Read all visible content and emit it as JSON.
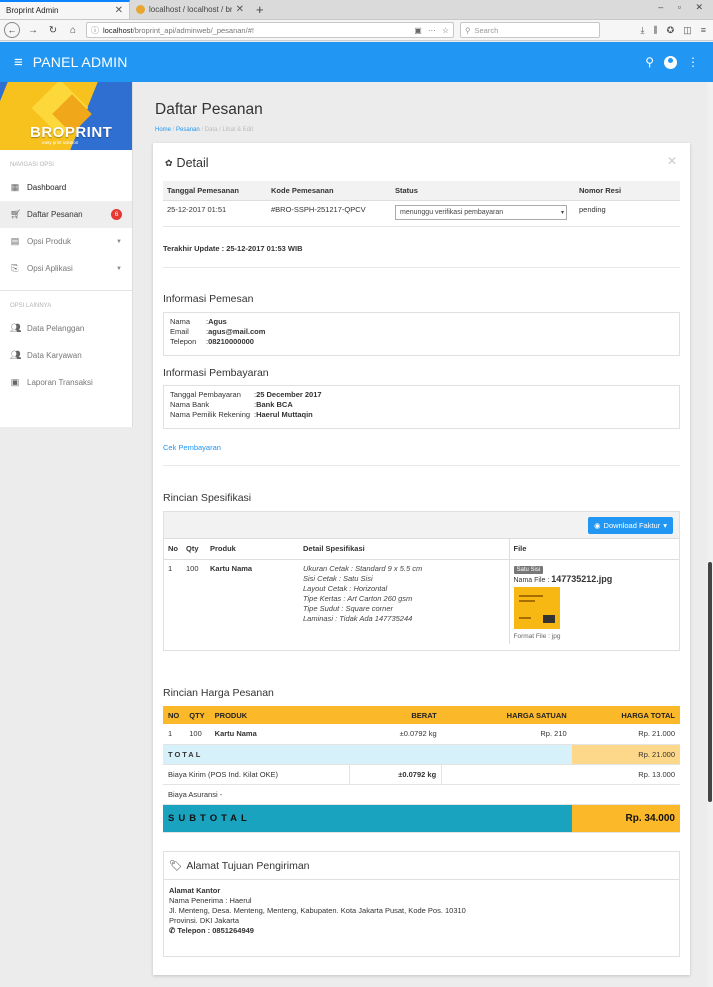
{
  "browser": {
    "tab_active": "Broprint Admin",
    "tab_inactive": "localhost / localhost / bropri",
    "url_host": "localhost",
    "url_path": "/broprint_api/adminweb/_pesanan/#!",
    "search_placeholder": "Search"
  },
  "header": {
    "title": "PANEL ADMIN"
  },
  "brand": {
    "name": "BROPRINT",
    "tagline": "easy print solution"
  },
  "sidebar": {
    "section1": "NAVIGASI OPSI",
    "items1": [
      {
        "label": "Dashboard"
      },
      {
        "label": "Daftar Pesanan",
        "badge": "6"
      },
      {
        "label": "Opsi Produk"
      },
      {
        "label": "Opsi Aplikasi"
      }
    ],
    "section2": "OPSI LAINNYA",
    "items2": [
      {
        "label": "Data Pelanggan"
      },
      {
        "label": "Data Karyawan"
      },
      {
        "label": "Laporan Transaksi"
      }
    ]
  },
  "page": {
    "title": "Daftar Pesanan",
    "breadcrumb": [
      "Home",
      "Pesanan",
      "Data",
      "Lihat & Edit"
    ]
  },
  "detail": {
    "title": "Detail",
    "columns": [
      "Tanggal Pemesanan",
      "Kode Pemesanan",
      "Status",
      "Nomor Resi"
    ],
    "row": {
      "tanggal": "25-12-2017 01:51",
      "kode": "#BRO-SSPH-251217-QPCV",
      "status": "menunggu verifikasi pembayaran",
      "resi": "pending"
    },
    "last_update": "Terakhir Update : 25-12-2017 01:53 WIB"
  },
  "pemesan": {
    "title": "Informasi Pemesan",
    "nama_label": "Nama",
    "nama": "Agus",
    "email_label": "Email",
    "email": "agus@mail.com",
    "telepon_label": "Telepon",
    "telepon": "08210000000"
  },
  "pembayaran": {
    "title": "Informasi Pembayaran",
    "tanggal_label": "Tanggal Pembayaran",
    "tanggal": "25 December 2017",
    "bank_label": "Nama Bank",
    "bank": "Bank BCA",
    "pemilik_label": "Nama Pemilik Rekening",
    "pemilik": "Haerul Muttaqin",
    "cek_link": "Cek Pembayaran"
  },
  "spesifikasi": {
    "title": "Rincian Spesifikasi",
    "download_label": "Download Faktur",
    "columns": [
      "No",
      "Qty",
      "Produk",
      "Detail Spesifikasi",
      "File"
    ],
    "row": {
      "no": "1",
      "qty": "100",
      "produk": "Kartu Nama",
      "specs": [
        "Ukuran Cetak : Standard 9 x 5.5 cm",
        "Sisi Cetak : Satu Sisi",
        "Layout Cetak : Horizontal",
        "Tipe Kertas : Art Carton 260 gsm",
        "Tipe Sudut : Square corner",
        "Laminasi : Tidak Ada 147735244"
      ],
      "file_badge": "Satu Sisi",
      "file_name_label": "Nama File :",
      "file_name": "147735212.jpg",
      "file_format": "Format File : jpg"
    }
  },
  "harga": {
    "title": "Rincian Harga Pesanan",
    "columns": [
      "NO",
      "QTY",
      "PRODUK",
      "BERAT",
      "HARGA SATUAN",
      "HARGA TOTAL"
    ],
    "row": {
      "no": "1",
      "qty": "100",
      "produk": "Kartu Nama",
      "berat": "±0.0792 kg",
      "satuan": "Rp. 210",
      "total": "Rp. 21.000"
    },
    "total_label": "TOTAL",
    "total_value": "Rp. 21.000",
    "kirim_label": "Biaya Kirim (POS Ind. Kilat OKE)",
    "kirim_berat": "±0.0792 kg",
    "kirim_value": "Rp. 13.000",
    "asuransi_label": "Biaya Asuransi -",
    "subtotal_label": "SUBTOTAL",
    "subtotal_value": "Rp. 34.000"
  },
  "alamat": {
    "title": "Alamat Tujuan Pengiriman",
    "type": "Alamat Kantor",
    "penerima": "Nama Penerima : Haerul",
    "jalan": "Jl. Menteng, Desa. Menteng, Menteng, Kabupaten. Kota Jakarta Pusat, Kode Pos. 10310",
    "provinsi": "Provinsi. DKI Jakarta",
    "telepon": "Telepon : 0851264949"
  },
  "colors": {
    "primary": "#2196f3",
    "amber": "#fbb829",
    "teal": "#19a3bf",
    "danger": "#e53935"
  },
  "icons": [
    "hamburger-icon",
    "search-icon",
    "account-icon",
    "more-vert-icon",
    "dashboard-icon",
    "cart-icon",
    "product-icon",
    "app-options-icon",
    "people-icon",
    "report-icon",
    "gear-icon",
    "tag-icon",
    "phone-icon",
    "close-icon"
  ]
}
